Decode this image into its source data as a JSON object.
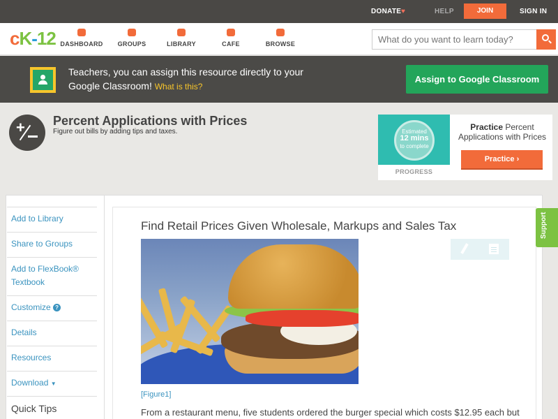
{
  "topbar": {
    "donate": "DONATE",
    "help": "HELP",
    "join": "JOIN",
    "signin": "SIGN IN"
  },
  "logo": {
    "c": "c",
    "k": "K",
    "dash": "-",
    "num": "12"
  },
  "nav": [
    {
      "label": "DASHBOARD",
      "icon": "dashboard-icon"
    },
    {
      "label": "GROUPS",
      "icon": "groups-icon"
    },
    {
      "label": "LIBRARY",
      "icon": "library-icon"
    },
    {
      "label": "CAFE",
      "icon": "cafe-icon"
    },
    {
      "label": "BROWSE",
      "icon": "browse-icon"
    }
  ],
  "search": {
    "placeholder": "What do you want to learn today?"
  },
  "banner": {
    "message": "Teachers, you can assign this resource directly to your Google Classroom!",
    "what": "What is this?",
    "assign": "Assign to Google Classroom"
  },
  "header": {
    "title": "Percent Applications with Prices",
    "subtitle": "Figure out bills by adding tips and taxes."
  },
  "practice": {
    "estimated": "Estimated",
    "mins": "12 mins",
    "complete": "to complete",
    "progress": "PROGRESS",
    "bold": "Practice",
    "rest": " Percent Applications with Prices",
    "button": "Practice"
  },
  "sidebar": {
    "items": [
      "Add to Library",
      "Share to Groups",
      "Add to FlexBook®",
      "Textbook",
      "Customize",
      "Details",
      "Resources",
      "Download"
    ],
    "quick_tips": "Quick Tips"
  },
  "article": {
    "title": "Find Retail Prices Given Wholesale, Markups and Sales Tax",
    "figure": "[Figure1]",
    "text": "From a restaurant menu, five students ordered the burger special which costs $12.95 each but"
  },
  "support": "Support",
  "colors": {
    "accent": "#f26b3a",
    "green": "#23a55a",
    "link": "#3a93bf"
  }
}
